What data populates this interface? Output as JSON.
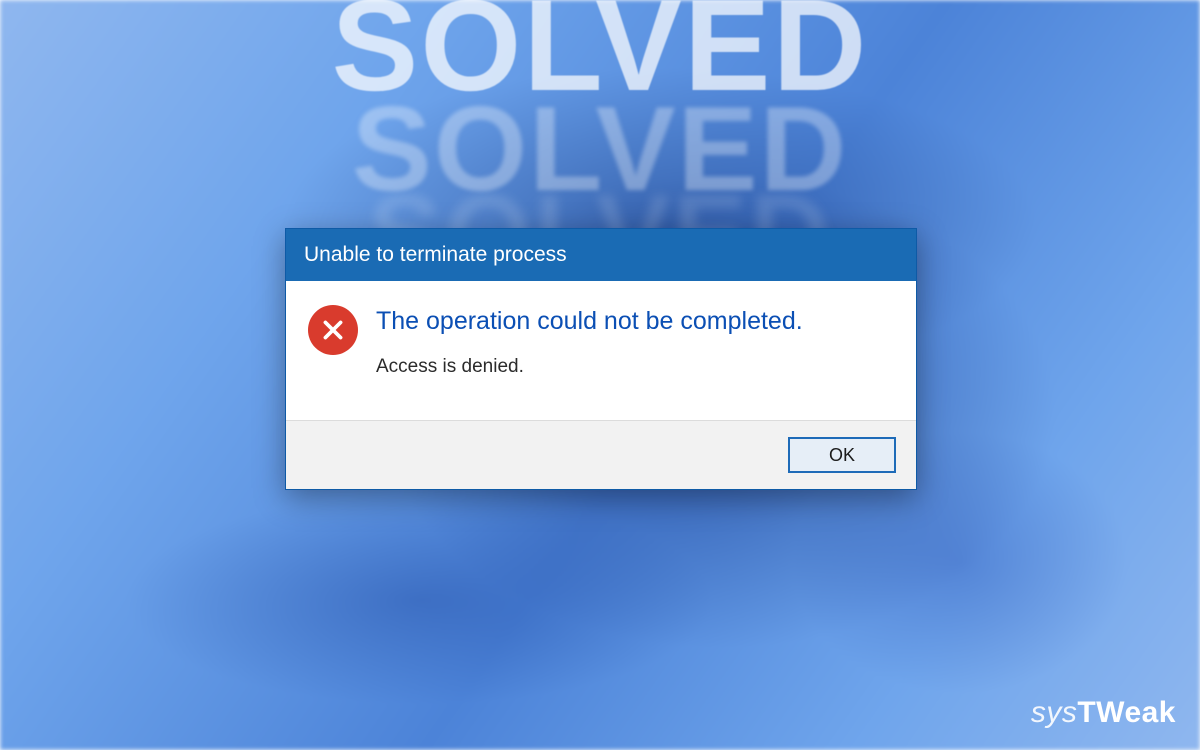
{
  "background": {
    "solved_text": "SOLVED"
  },
  "dialog": {
    "title": "Unable to terminate process",
    "icon": "error-icon",
    "primary_message": "The operation could not be completed.",
    "secondary_message": "Access is denied.",
    "ok_label": "OK"
  },
  "watermark": {
    "part1": "sys",
    "part2": "TWeak"
  },
  "colors": {
    "titlebar": "#1a6bb4",
    "error_icon": "#d93b2d",
    "primary_text": "#0b4fb4",
    "button_border": "#1e6bb8"
  }
}
